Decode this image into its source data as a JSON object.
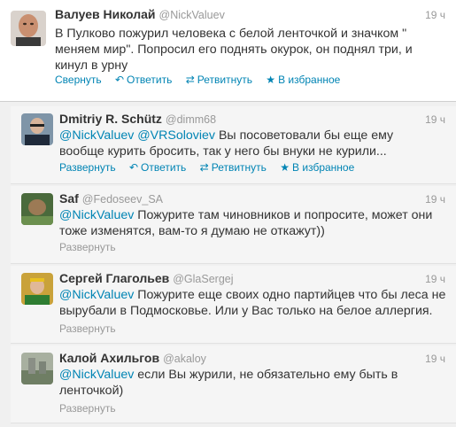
{
  "main_tweet": {
    "fullname": "Валуев Николай",
    "username": "@NickValuev",
    "time": "19 ч",
    "text": "В Пулково пожурил человека с белой ленточкой и значком \" меняем мир\". Попросил его поднять окурок, он поднял три, и кинул в урну",
    "actions": {
      "collapse": "Свернуть",
      "reply": "Ответить",
      "retweet": "Ретвитнуть",
      "favorite": "В избранное"
    }
  },
  "replies": [
    {
      "fullname": "Dmitriy R. Schütz",
      "username": "@dimm68",
      "time": "19 ч",
      "mention1": "@NickValuev",
      "mention2": "@VRSoloviev",
      "text": " Вы посоветовали бы еще ему вообще курить бросить, так у него бы внуки не курили...",
      "actions": {
        "expand": "Развернуть",
        "reply": "Ответить",
        "retweet": "Ретвитнуть",
        "favorite": "В избранное"
      }
    },
    {
      "fullname": "Saf",
      "username": "@Fedoseev_SA",
      "time": "19 ч",
      "mention1": "@NickValuev",
      "text": " Пожурите там чиновников и попросите, может они тоже изменятся, вам-то я думаю не откажут))",
      "actions": {
        "expand": "Развернуть"
      }
    },
    {
      "fullname": "Сергей Глагольев",
      "username": "@GlaSergej",
      "time": "19 ч",
      "mention1": "@NickValuev",
      "text": " Пожурите еще своих одно партийцев что бы леса не вырубали в Подмосковье. Или у Вас только на белое аллергия.",
      "actions": {
        "expand": "Развернуть"
      }
    },
    {
      "fullname": "Калой Ахильгов",
      "username": "@akaloy",
      "time": "19 ч",
      "mention1": "@NickValuev",
      "text": " если Вы журили, не обязательно ему быть в ленточкой)",
      "actions": {
        "expand": "Развернуть"
      }
    }
  ],
  "icons": {
    "reply": "reply-arrow-icon",
    "retweet": "retweet-icon",
    "favorite": "star-icon"
  },
  "colors": {
    "link": "#0084b4",
    "muted": "#999999",
    "text": "#333333"
  }
}
